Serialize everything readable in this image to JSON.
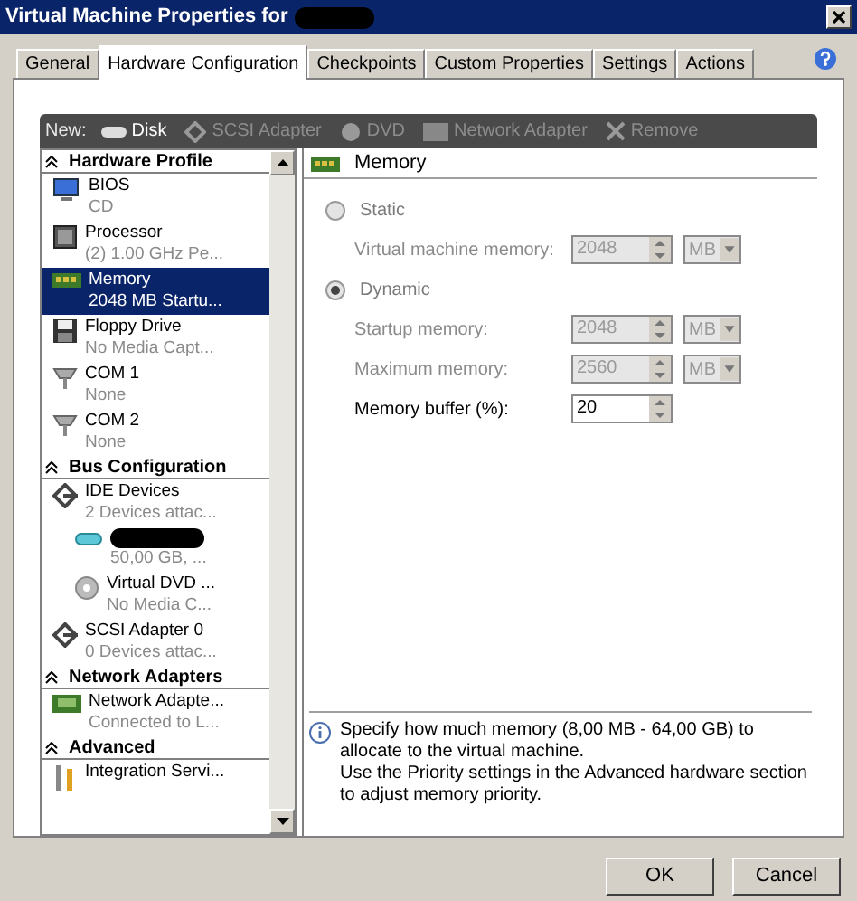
{
  "window": {
    "title": "Virtual Machine Properties for"
  },
  "tabs": [
    {
      "label": "General",
      "selected": false
    },
    {
      "label": "Hardware Configuration",
      "selected": true
    },
    {
      "label": "Checkpoints",
      "selected": false
    },
    {
      "label": "Custom Properties",
      "selected": false
    },
    {
      "label": "Settings",
      "selected": false
    },
    {
      "label": "Actions",
      "selected": false
    }
  ],
  "toolbar": {
    "label": "New:",
    "buttons": [
      {
        "label": "Disk",
        "kind": "disk",
        "disabled": false
      },
      {
        "label": "SCSI Adapter",
        "kind": "scsi",
        "disabled": true
      },
      {
        "label": "DVD",
        "kind": "dvd",
        "disabled": true
      },
      {
        "label": "Network Adapter",
        "kind": "network",
        "disabled": true
      },
      {
        "label": "Remove",
        "kind": "remove",
        "disabled": true
      }
    ]
  },
  "sections": [
    {
      "title": "Hardware Profile",
      "items": [
        {
          "kind": "bios",
          "name": "BIOS",
          "detail": "CD",
          "selected": false
        },
        {
          "kind": "processor",
          "name": "Processor",
          "detail": "(2) 1.00 GHz Pe...",
          "selected": false
        },
        {
          "kind": "memory",
          "name": "Memory",
          "detail": "2048 MB Startu...",
          "selected": true
        },
        {
          "kind": "floppy",
          "name": "Floppy Drive",
          "detail": "No Media Capt...",
          "selected": false
        },
        {
          "kind": "com",
          "name": "COM 1",
          "detail": "None",
          "selected": false
        },
        {
          "kind": "com",
          "name": "COM 2",
          "detail": "None",
          "selected": false
        }
      ]
    },
    {
      "title": "Bus Configuration",
      "items": [
        {
          "kind": "bus",
          "name": "IDE Devices",
          "detail": "2 Devices attac...",
          "selected": false,
          "children": [
            {
              "kind": "disk",
              "redacted": true,
              "detail": "50,00 GB, ...",
              "selected": false
            },
            {
              "kind": "dvd",
              "name": "Virtual DVD ...",
              "detail": "No Media C...",
              "selected": false
            }
          ]
        },
        {
          "kind": "bus",
          "name": "SCSI Adapter 0",
          "detail": "0 Devices attac...",
          "selected": false
        }
      ]
    },
    {
      "title": "Network Adapters",
      "items": [
        {
          "kind": "network",
          "name": "Network Adapte...",
          "detail": "Connected to L...",
          "selected": false
        }
      ]
    },
    {
      "title": "Advanced",
      "items": [
        {
          "kind": "integration",
          "name": "Integration Servi...",
          "selected": false
        }
      ]
    }
  ],
  "panel": {
    "title": "Memory",
    "rows": [
      {
        "kind": "radio",
        "label": "Static",
        "selected": false
      },
      {
        "kind": "spin",
        "label": "Virtual machine memory:",
        "value": "2048",
        "unit": "MB",
        "disabled": true
      },
      {
        "kind": "radio",
        "label": "Dynamic",
        "selected": true
      },
      {
        "kind": "spin",
        "label": "Startup memory:",
        "value": "2048",
        "unit": "MB",
        "disabled": true
      },
      {
        "kind": "spin",
        "label": "Maximum memory:",
        "value": "2560",
        "unit": "MB",
        "disabled": true
      },
      {
        "kind": "spin",
        "label": "Memory buffer (%):",
        "value": "20",
        "disabled": false
      }
    ],
    "info": [
      "Specify how much memory (8,00 MB - 64,00 GB) to allocate to the virtual machine.",
      "Use the Priority settings in the Advanced hardware section to adjust memory priority."
    ]
  },
  "buttons": [
    "OK",
    "Cancel"
  ]
}
